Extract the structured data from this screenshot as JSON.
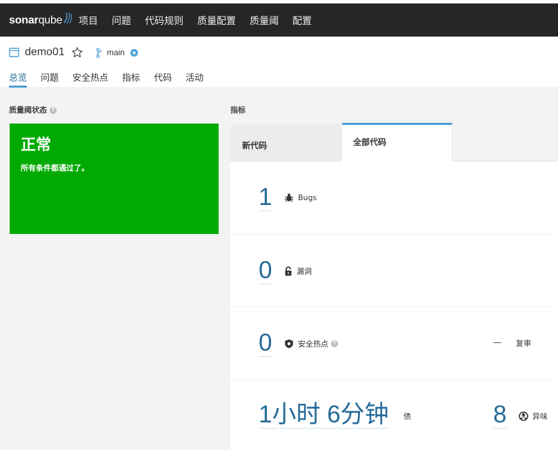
{
  "brand": {
    "name_bold": "sonar",
    "name_light": "qube"
  },
  "topnav": [
    "项目",
    "问题",
    "代码规则",
    "质量配置",
    "质量阈",
    "配置"
  ],
  "project": {
    "name": "demo01",
    "branch": "main"
  },
  "tabs": [
    "总览",
    "问题",
    "安全热点",
    "指标",
    "代码",
    "活动"
  ],
  "quality_gate": {
    "label": "质量阈状态",
    "status": "正常",
    "message": "所有条件都通过了。",
    "color": "#00aa00"
  },
  "measures": {
    "label": "指标",
    "tab_new": "新代码",
    "tab_overall": "全部代码",
    "bugs": {
      "value": "1",
      "label": "Bugs"
    },
    "vulnerabilities": {
      "value": "0",
      "label": "漏洞"
    },
    "hotspots": {
      "value": "0",
      "label": "安全热点",
      "review_dash": "—",
      "review_label": "复审"
    },
    "debt": {
      "value": "1小时 6分钟",
      "label": "债"
    },
    "code_smells": {
      "value": "8",
      "label": "异味"
    }
  },
  "colors": {
    "accent": "#4b9fd5",
    "metric": "#236a97",
    "topbar": "#262626"
  }
}
